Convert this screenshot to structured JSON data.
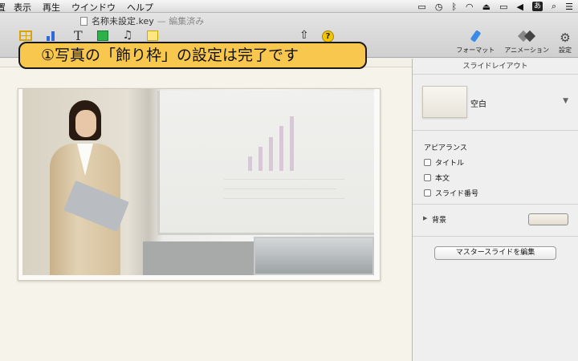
{
  "menubar": {
    "items": [
      "置",
      "表示",
      "再生",
      "ウインドウ",
      "ヘルプ"
    ],
    "status_ime": "あ"
  },
  "document": {
    "title": "名称未設定.key",
    "edited": "— 編集済み"
  },
  "toolbar": {
    "format_label": "フォーマット",
    "animation_label": "アニメーション",
    "settings_label": "設定"
  },
  "callout": {
    "text": "①写真の「飾り枠」の設定は完了です"
  },
  "inspector": {
    "title": "スライドレイアウト",
    "layout_name": "空白",
    "appearance": {
      "heading": "アピアランス",
      "options": [
        "タイトル",
        "本文",
        "スライド番号"
      ]
    },
    "background_label": "背景",
    "edit_master_button": "マスタースライドを編集"
  },
  "colors": {
    "callout_fill": "#f8c84e",
    "format_accent": "#3a8be8"
  }
}
